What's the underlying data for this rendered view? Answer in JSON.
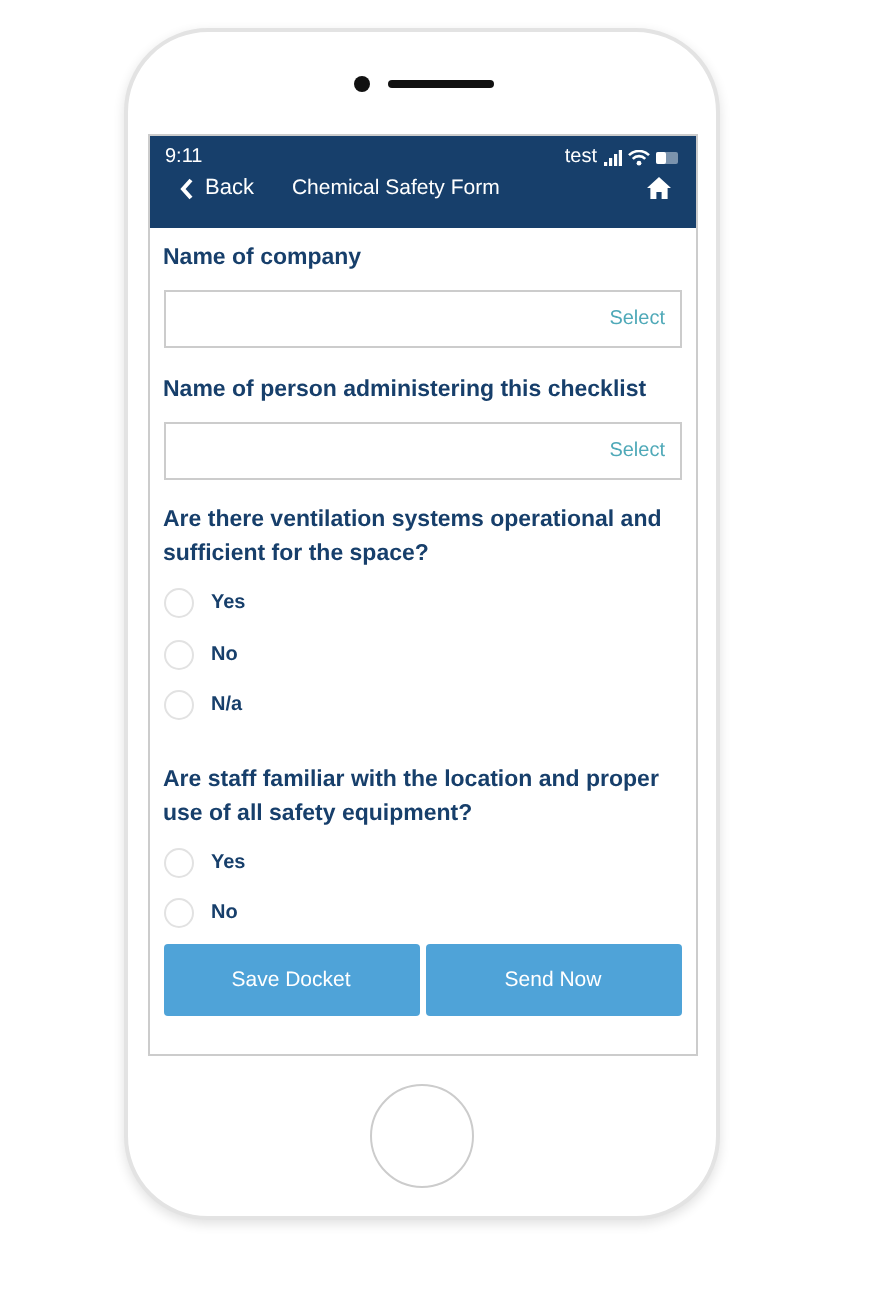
{
  "status_bar": {
    "time": "9:11",
    "carrier": "test"
  },
  "nav_bar": {
    "back": "Back",
    "title": "Chemical Safety Form"
  },
  "fields": [
    {
      "label": "Name of company",
      "placeholder": "Select"
    },
    {
      "label": "Name of person administering this checklist",
      "placeholder": "Select"
    }
  ],
  "questions": [
    {
      "text": "Are there ventilation systems operational and sufficient for the space?",
      "options": [
        {
          "label": "Yes",
          "selected": false
        },
        {
          "label": "No",
          "selected": false
        },
        {
          "label": "N/a",
          "selected": false
        }
      ]
    },
    {
      "text": "Are staff familiar with the location and proper use of all safety equipment?",
      "options": [
        {
          "label": "Yes",
          "selected": false
        },
        {
          "label": "No",
          "selected": false
        }
      ]
    }
  ],
  "buttons": [
    "Save Docket",
    "Send Now"
  ]
}
